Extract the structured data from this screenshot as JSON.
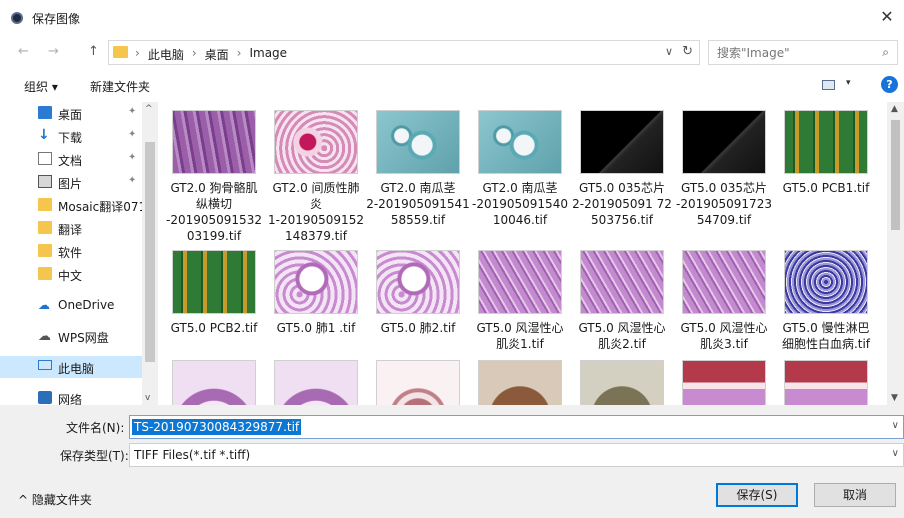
{
  "window": {
    "title": "保存图像",
    "close": "✕"
  },
  "nav": {
    "back": "←",
    "forward": "→",
    "up": "↑",
    "address_separators": [
      "›",
      "›",
      "›"
    ],
    "address_dropdown": "∨",
    "refresh": "↻"
  },
  "address": {
    "crumbs": [
      "此电脑",
      "桌面",
      "Image"
    ]
  },
  "search": {
    "placeholder": "搜索\"Image\"",
    "icon": "⌕"
  },
  "toolbar": {
    "organize": "组织 ▾",
    "new_folder": "新建文件夹",
    "view_dropdown": "▾",
    "help": "?"
  },
  "sidebar": {
    "items": [
      {
        "label": "桌面",
        "icon": "desktop-icon",
        "pinned": true
      },
      {
        "label": "下载",
        "icon": "download-icon",
        "pinned": true
      },
      {
        "label": "文档",
        "icon": "document-icon",
        "pinned": true
      },
      {
        "label": "图片",
        "icon": "picture-icon",
        "pinned": true
      },
      {
        "label": "Mosaic翻译071",
        "icon": "folder-icon",
        "pinned": false
      },
      {
        "label": "翻译",
        "icon": "folder-icon",
        "pinned": false
      },
      {
        "label": "软件",
        "icon": "folder-icon",
        "pinned": false
      },
      {
        "label": "中文",
        "icon": "folder-icon",
        "pinned": false
      },
      {
        "label": "OneDrive",
        "icon": "onedrive-icon",
        "pinned": false
      },
      {
        "label": "WPS网盘",
        "icon": "wps-cloud-icon",
        "pinned": false
      },
      {
        "label": "此电脑",
        "icon": "this-pc-icon",
        "pinned": false,
        "selected": true
      },
      {
        "label": "网络",
        "icon": "network-icon",
        "pinned": false
      }
    ],
    "pin_glyph": "📌"
  },
  "scroll_glyphs": {
    "up": "▲",
    "down": "▼",
    "sidebar_up": "^",
    "sidebar_down": "v"
  },
  "files": [
    {
      "name": "GT2.0 狗骨骼肌纵横切-20190509153203199.tif",
      "lines": [
        "GT2.0 狗骨骼肌",
        "纵横切",
        "-201905091532",
        "03199.tif"
      ],
      "thumb": "muscle"
    },
    {
      "name": "GT2.0 间质性肺炎1-20190509152148379.tif",
      "lines": [
        "GT2.0 间质性肺",
        "炎",
        "1-20190509152",
        "148379.tif"
      ],
      "thumb": "lung-pink"
    },
    {
      "name": "GT2.0 南瓜茎2-20190509154158559.tif",
      "lines": [
        "GT2.0 南瓜茎",
        "2-201905091541",
        "58559.tif"
      ],
      "thumb": "stem"
    },
    {
      "name": "GT2.0 南瓜茎-2019050915401 0046.tif",
      "lines": [
        "GT2.0 南瓜茎",
        "-201905091540",
        "10046.tif"
      ],
      "thumb": "stem"
    },
    {
      "name": "GT5.0 035芯片2-20190509172503756.tif",
      "lines": [
        "GT5.0 035芯片",
        "2-201905091 72",
        "503756.tif"
      ],
      "thumb": "chip"
    },
    {
      "name": "GT5.0 035芯片-20190509172354709.tif",
      "lines": [
        "GT5.0 035芯片",
        "-201905091723",
        "54709.tif"
      ],
      "thumb": "chip"
    },
    {
      "name": "GT5.0 PCB1.tif",
      "lines": [
        "GT5.0 PCB1.tif"
      ],
      "thumb": "pcb"
    },
    {
      "name": "GT5.0 PCB2.tif",
      "lines": [
        "GT5.0 PCB2.tif"
      ],
      "thumb": "pcb"
    },
    {
      "name": "GT5.0 肺1 .tif",
      "lines": [
        "GT5.0 肺1 .tif"
      ],
      "thumb": "lung"
    },
    {
      "name": "GT5.0 肺2.tif",
      "lines": [
        "GT5.0 肺2.tif"
      ],
      "thumb": "lung"
    },
    {
      "name": "GT5.0 风湿性心肌炎1.tif",
      "lines": [
        "GT5.0 风湿性心",
        "肌炎1.tif"
      ],
      "thumb": "heart"
    },
    {
      "name": "GT5.0 风湿性心肌炎2.tif",
      "lines": [
        "GT5.0 风湿性心",
        "肌炎2.tif"
      ],
      "thumb": "heart"
    },
    {
      "name": "GT5.0 风湿性心肌炎3.tif",
      "lines": [
        "GT5.0 风湿性心",
        "肌炎3.tif"
      ],
      "thumb": "heart"
    },
    {
      "name": "GT5.0 慢性淋巴细胞性白血病.tif",
      "lines": [
        "GT5.0 慢性淋巴",
        "细胞性白血病.tif"
      ],
      "thumb": "blood"
    },
    {
      "name": "",
      "lines": [],
      "thumb": "intestine"
    },
    {
      "name": "",
      "lines": [],
      "thumb": "intestine"
    },
    {
      "name": "",
      "lines": [],
      "thumb": "ring"
    },
    {
      "name": "",
      "lines": [],
      "thumb": "coin-copper"
    },
    {
      "name": "",
      "lines": [],
      "thumb": "coin-silver"
    },
    {
      "name": "",
      "lines": [],
      "thumb": "tissue-red"
    },
    {
      "name": "",
      "lines": [],
      "thumb": "tissue-red"
    }
  ],
  "form": {
    "filename_label": "文件名(N):",
    "filename_value": "TS-20190730084329877.tif",
    "filetype_label": "保存类型(T):",
    "filetype_value": "TIFF Files(*.tif *.tiff)",
    "dropdown_glyph": "∨"
  },
  "footer": {
    "hide_folders": "^ 隐藏文件夹",
    "save": "保存(S)",
    "cancel": "取消"
  },
  "colors": {
    "accent": "#0078d7",
    "selection": "#cce8ff",
    "folder": "#f4c64e"
  }
}
